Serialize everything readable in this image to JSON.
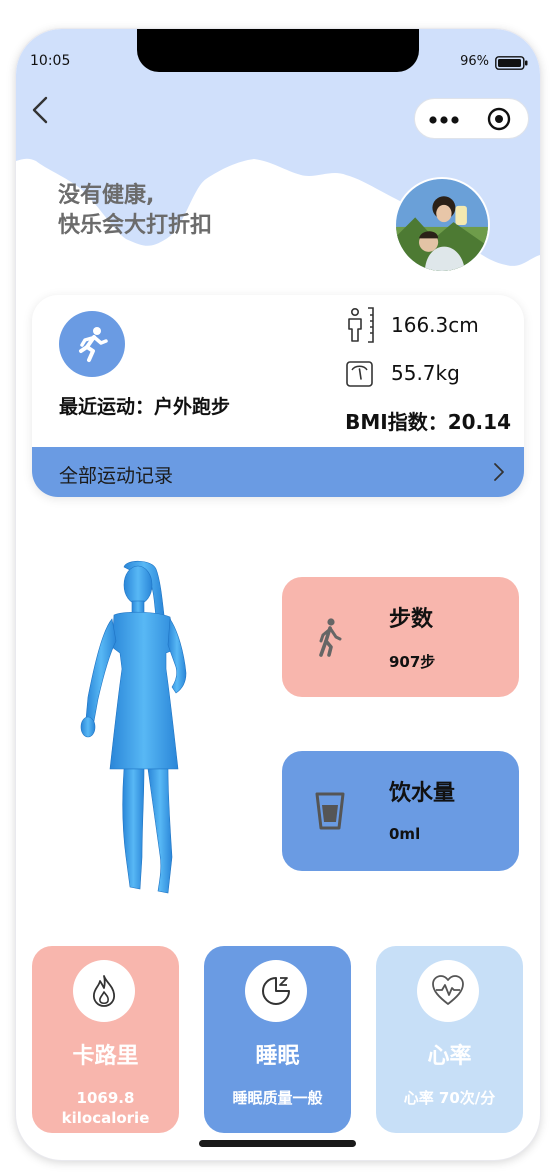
{
  "status_bar": {
    "time": "10:05",
    "battery": "96%"
  },
  "nav": {
    "back_icon": "chevron-left-icon",
    "menu_icon": "more-dots-icon",
    "target_icon": "target-icon"
  },
  "header": {
    "slogan_line1": "没有健康,",
    "slogan_line2": "快乐会大打折扣"
  },
  "profile": {
    "recent_label": "最近运动：户外跑步",
    "height": "166.3cm",
    "weight": "55.7kg",
    "bmi": "BMI指数：20.14",
    "all_records": "全部运动记录"
  },
  "tiles": {
    "steps": {
      "title": "步数",
      "value": "907步",
      "color": "#f8b6ad"
    },
    "water": {
      "title": "饮水量",
      "value": "0ml",
      "color": "#6a9be3"
    }
  },
  "bottom": {
    "calories": {
      "title": "卡路里",
      "value_line1": "1069.8",
      "value_line2": "kilocalorie",
      "color": "#f8b6ad"
    },
    "sleep": {
      "title": "睡眠",
      "value": "睡眠质量一般",
      "color": "#6a9be3"
    },
    "heart": {
      "title": "心率",
      "value": "心率 70次/分",
      "color": "#c7dff7"
    }
  },
  "colors": {
    "header_bg": "#d0e0fb",
    "accent_blue": "#6a9be3",
    "figure_blue": "#3ea0e8"
  }
}
